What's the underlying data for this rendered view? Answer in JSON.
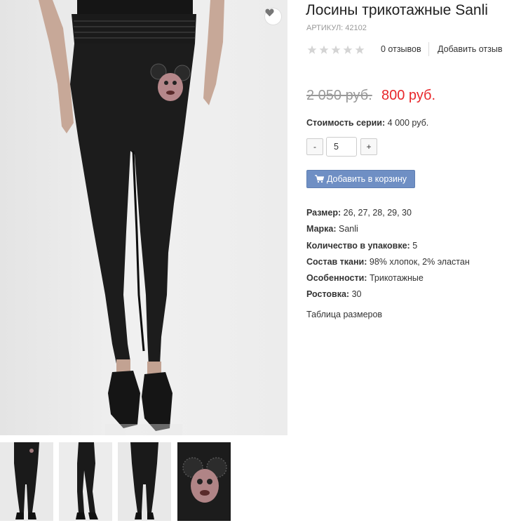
{
  "product": {
    "title": "Лосины трикотажные Sanli",
    "sku": "АРТИКУЛ: 42102",
    "rating": {
      "value": 0,
      "max": 5
    },
    "reviews_count": "0 отзывов",
    "add_review": "Добавить отзыв",
    "old_price": "2 050 руб.",
    "new_price": "800 руб.",
    "series_cost_label": "Стоимость серии:",
    "series_cost_value": " 4 000 руб.",
    "quantity": {
      "minus": "-",
      "value": "5",
      "plus": "+"
    },
    "add_to_cart": "Добавить в корзину",
    "properties": [
      {
        "label": "Размер:",
        "value": " 26, 27, 28, 29, 30"
      },
      {
        "label": "Марка:",
        "value": " Sanli"
      },
      {
        "label": "Количество в упаковке:",
        "value": " 5"
      },
      {
        "label": "Состав ткани:",
        "value": " 98% хлопок, 2% эластан"
      },
      {
        "label": "Особенности:",
        "value": " Трикотажные"
      },
      {
        "label": "Ростовка:",
        "value": " 30"
      }
    ],
    "size_table_link": "Таблица размеров"
  },
  "gallery": {
    "thumbnails": [
      "front-view",
      "side-view",
      "back-view",
      "detail-view"
    ]
  },
  "colors": {
    "accent_price": "#e8262a",
    "button_bg": "#6f8fc4",
    "star_empty": "#d4d4d4",
    "leggings": "#1c1c1c"
  },
  "icons": {
    "favorite": "heart-icon",
    "rating": "star-icon",
    "cart": "cart-icon"
  }
}
